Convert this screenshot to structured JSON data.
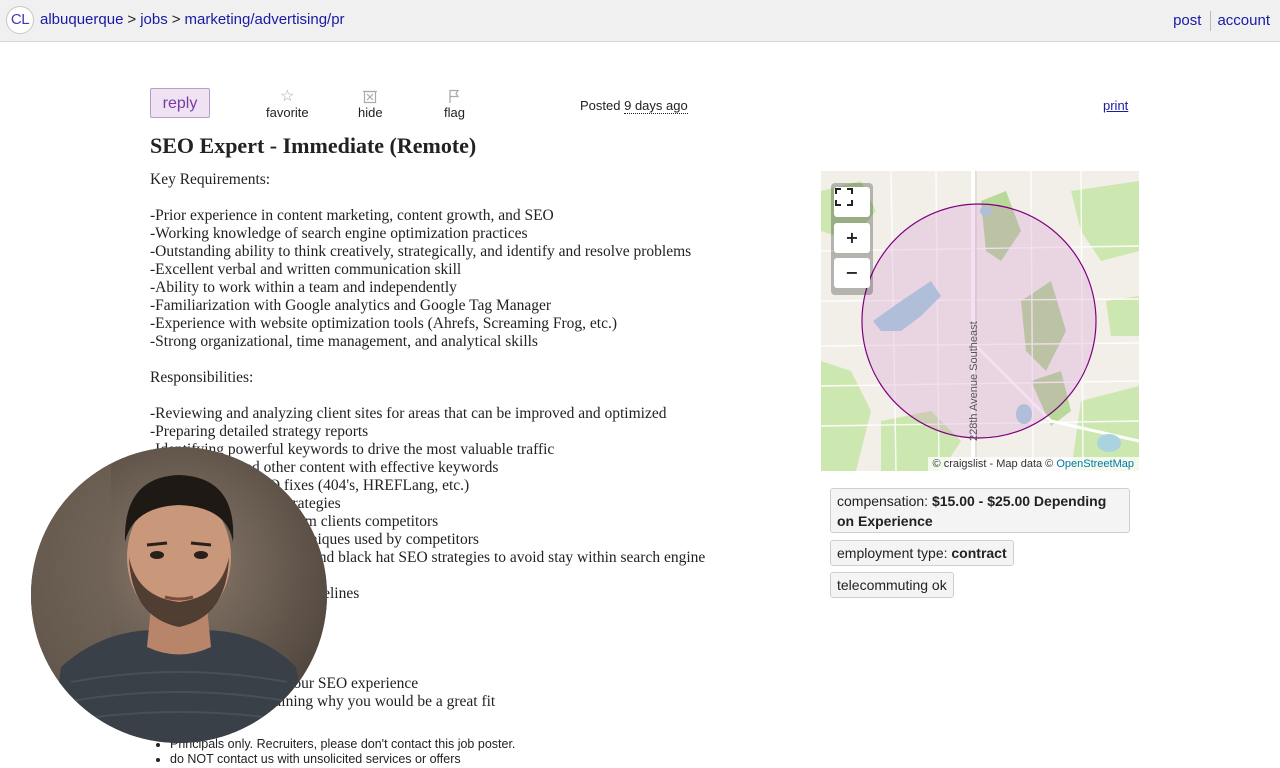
{
  "header": {
    "logo": "CL",
    "breadcrumbs": [
      "albuquerque",
      "jobs",
      "marketing/advertising/pr"
    ],
    "separator": ">",
    "links": {
      "post": "post",
      "account": "account"
    }
  },
  "actions": {
    "reply": "reply",
    "favorite": "favorite",
    "hide": "hide",
    "flag": "flag",
    "posted_label": "Posted",
    "posted_time": "9 days ago",
    "print": "print"
  },
  "posting": {
    "title": "SEO Expert - Immediate (Remote)",
    "body_lines": [
      "Key Requirements:",
      "",
      "-Prior experience in content marketing, content growth, and SEO",
      "-Working knowledge of search engine optimization practices",
      "-Outstanding ability to think creatively, strategically, and identify and resolve problems",
      "-Excellent verbal and written communication skill",
      "-Ability to work within a team and independently",
      "-Familiarization with Google analytics and Google Tag Manager",
      "-Experience with website optimization tools (Ahrefs, Screaming Frog, etc.)",
      "-Strong organizational, time management, and analytical skills",
      "",
      "Responsibilities:",
      "",
      "-Reviewing and analyzing client sites for areas that can be improved and optimized",
      "-Preparing detailed strategy reports",
      "-Identifying powerful keywords to drive the most valuable traffic",
      "                    s and other content with effective keywords",
      "                          SEO fixes (404's, HREFLang, etc.)",
      "                          ding strategies",
      "                          404's from clients competitors",
      "                          SEO techniques used by competitors",
      "                          white hat and black hat SEO strategies to avoid stay within search engine",
      "",
      "                             SEO guidelines",
      "                             r clients",
      "",
      "",
      "",
      "                    detailing your SEO experience",
      "                    ter explaining why you would be a great fit"
    ]
  },
  "map": {
    "zoom_in": "+",
    "zoom_out": "−",
    "fullscreen": "⛶",
    "road_label": "228th Avenue Southeast",
    "attribution_prefix": "© craigslist - Map data ©",
    "attribution_link": "OpenStreetMap"
  },
  "attributes": {
    "compensation_label": "compensation:",
    "compensation_value_line1": "$15.00 - $25.00 Depending",
    "compensation_value_line2": "on Experience",
    "employment_label": "employment type:",
    "employment_value": "contract",
    "telecommuting": "telecommuting ok"
  },
  "notices": [
    "Principals only. Recruiters, please don't contact this job poster.",
    "do NOT contact us with unsolicited services or offers"
  ],
  "colors": {
    "link": "#1a1aa6",
    "reply_bg": "#eee2f3",
    "reply_text": "#7b3aa0",
    "map_circle": "#800080"
  }
}
